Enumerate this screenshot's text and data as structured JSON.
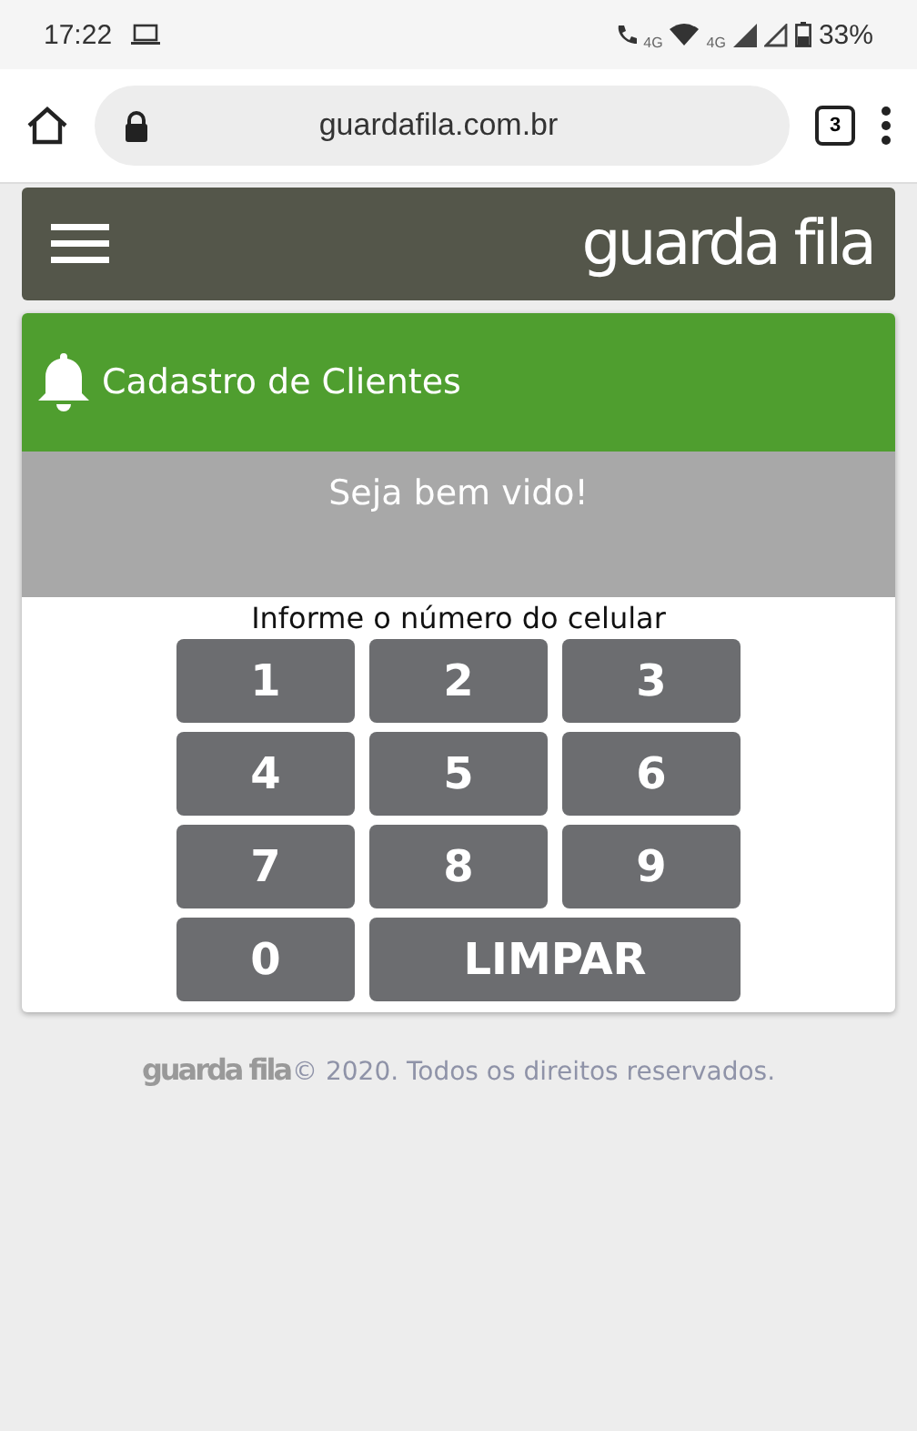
{
  "status_bar": {
    "time": "17:22",
    "network_labels": [
      "4G",
      "4G"
    ],
    "battery": "33%"
  },
  "browser": {
    "url": "guardafila.com.br",
    "tab_count": "3"
  },
  "header": {
    "logo": "guarda fila"
  },
  "card": {
    "title": "Cadastro de Clientes",
    "welcome": "Seja bem vido!",
    "prompt": "Informe o número do celular",
    "keys": [
      {
        "label": "1",
        "kind": "digit"
      },
      {
        "label": "2",
        "kind": "digit"
      },
      {
        "label": "3",
        "kind": "digit"
      },
      {
        "label": "4",
        "kind": "digit"
      },
      {
        "label": "5",
        "kind": "digit"
      },
      {
        "label": "6",
        "kind": "digit"
      },
      {
        "label": "7",
        "kind": "digit"
      },
      {
        "label": "8",
        "kind": "digit"
      },
      {
        "label": "9",
        "kind": "digit"
      },
      {
        "label": "0",
        "kind": "digit"
      },
      {
        "label": "LIMPAR",
        "kind": "clear"
      }
    ]
  },
  "footer": {
    "logo": "guarda fila",
    "copyright": "© 2020. Todos os direitos reservados."
  }
}
